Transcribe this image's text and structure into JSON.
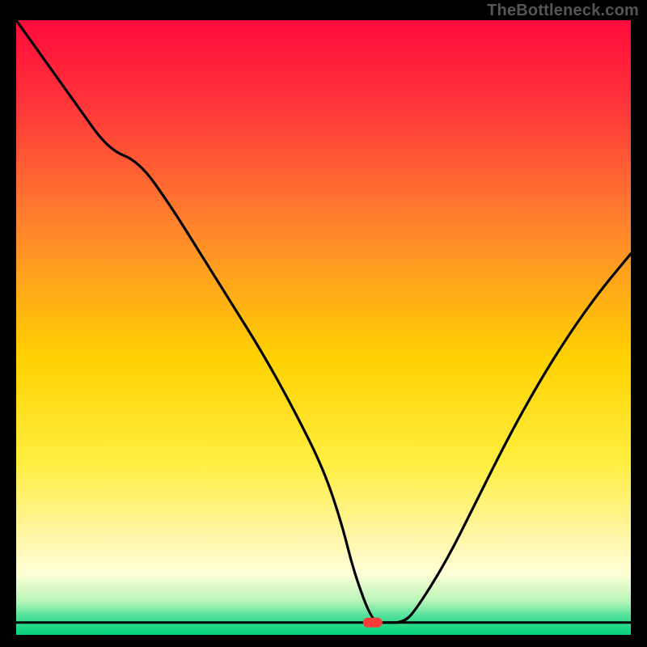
{
  "watermark": "TheBottleneck.com",
  "chart_data": {
    "type": "line",
    "title": "",
    "xlabel": "",
    "ylabel": "",
    "xlim": [
      0,
      100
    ],
    "ylim": [
      0,
      100
    ],
    "grid": false,
    "background_gradient_stops": [
      {
        "offset": 0.0,
        "color": "#ff0a3a"
      },
      {
        "offset": 0.15,
        "color": "#ff3a3a"
      },
      {
        "offset": 0.35,
        "color": "#ff8a2a"
      },
      {
        "offset": 0.55,
        "color": "#ffd200"
      },
      {
        "offset": 0.72,
        "color": "#ffee40"
      },
      {
        "offset": 0.84,
        "color": "#fff6a6"
      },
      {
        "offset": 0.9,
        "color": "#ffffd8"
      },
      {
        "offset": 0.945,
        "color": "#b8f5b8"
      },
      {
        "offset": 0.97,
        "color": "#4fe09a"
      },
      {
        "offset": 1.0,
        "color": "#00d27a"
      }
    ],
    "series": [
      {
        "name": "bottleneck-curve",
        "x": [
          0,
          5,
          10,
          15,
          20,
          25,
          30,
          35,
          40,
          45,
          50,
          53,
          55,
          58,
          60,
          63,
          65,
          70,
          75,
          80,
          85,
          90,
          95,
          100
        ],
        "y": [
          100,
          93,
          86,
          79,
          77,
          70,
          62,
          54,
          46,
          37,
          27,
          18,
          10,
          2,
          2,
          2,
          4,
          12,
          22,
          32,
          41,
          49,
          56,
          62
        ]
      }
    ],
    "marker": {
      "x": 58,
      "y": 2,
      "color": "#ff3a3a"
    }
  }
}
